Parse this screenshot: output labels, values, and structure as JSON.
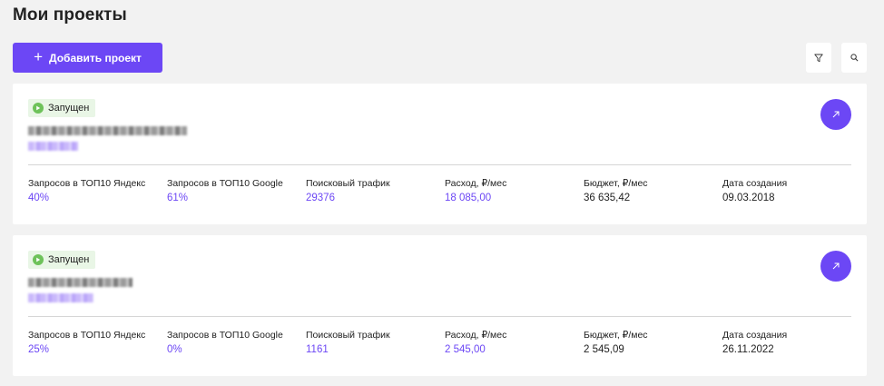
{
  "page": {
    "title": "Мои проекты"
  },
  "toolbar": {
    "add_project_label": "Добавить проект",
    "filter_icon": "filter-icon",
    "search_icon": "search-icon"
  },
  "colors": {
    "accent": "#6c47f5",
    "status_running_bg": "#e9f6e6",
    "status_running_icon": "#6ec25a"
  },
  "projects": [
    {
      "status": "Запущен",
      "metrics": [
        {
          "label": "Запросов в ТОП10 Яндекс",
          "value": "40%"
        },
        {
          "label": "Запросов в ТОП10 Google",
          "value": "61%"
        },
        {
          "label": "Поисковый трафик",
          "value": "29376"
        },
        {
          "label": "Расход, ₽/мес",
          "value": "18 085,00"
        },
        {
          "label": "Бюджет, ₽/мес",
          "value": "36 635,42"
        },
        {
          "label": "Дата создания",
          "value": "09.03.2018"
        }
      ]
    },
    {
      "status": "Запущен",
      "metrics": [
        {
          "label": "Запросов в ТОП10 Яндекс",
          "value": "25%"
        },
        {
          "label": "Запросов в ТОП10 Google",
          "value": "0%"
        },
        {
          "label": "Поисковый трафик",
          "value": "1161"
        },
        {
          "label": "Расход, ₽/мес",
          "value": "2 545,00"
        },
        {
          "label": "Бюджет, ₽/мес",
          "value": "2 545,09"
        },
        {
          "label": "Дата создания",
          "value": "26.11.2022"
        }
      ]
    }
  ]
}
